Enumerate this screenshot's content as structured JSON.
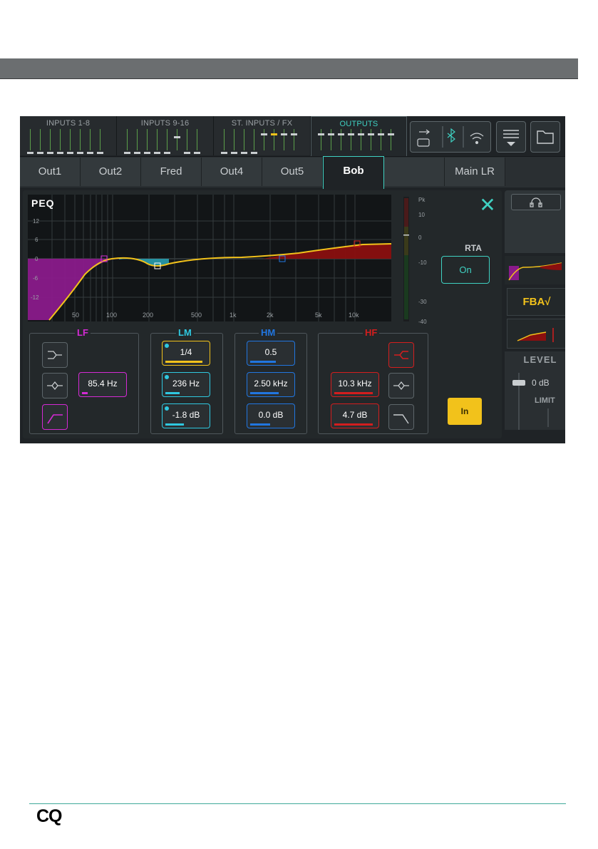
{
  "section_tabs": [
    "INPUTS 1-8",
    "INPUTS 9-16",
    "ST. INPUTS / FX",
    "OUTPUTS"
  ],
  "channel_tabs": [
    "Out1",
    "Out2",
    "Fred",
    "Out4",
    "Out5",
    "Bob",
    "",
    "Main LR"
  ],
  "active_channel": "Bob",
  "peq": {
    "title": "PEQ",
    "y_ticks": [
      "12",
      "6",
      "0",
      "-6",
      "-12"
    ],
    "x_ticks": [
      "50",
      "100",
      "200",
      "500",
      "1k",
      "2k",
      "5k",
      "10k"
    ],
    "meter_ticks": [
      "Pk",
      "10",
      "0",
      "-10",
      "-30",
      "-40"
    ]
  },
  "rta": {
    "label": "RTA",
    "state": "On"
  },
  "bands": {
    "lf": {
      "title": "LF",
      "freq": "85.4 Hz",
      "color": "#d42ad4"
    },
    "lm": {
      "title": "LM",
      "q": "1/4",
      "freq": "236 Hz",
      "gain": "-1.8 dB",
      "color": "#2fc8e0"
    },
    "hm": {
      "title": "HM",
      "q": "0.5",
      "freq": "2.50 kHz",
      "gain": "0.0 dB",
      "color": "#2176e0"
    },
    "hf": {
      "title": "HF",
      "freq": "10.3 kHz",
      "gain": "4.7 dB",
      "color": "#d41e1e"
    }
  },
  "in_button": "In",
  "side": {
    "fba": "FBA√",
    "level_label": "LEVEL",
    "level_value": "0 dB",
    "limit_label": "LIMIT"
  },
  "footer": {
    "logo": "CQ"
  },
  "colors": {
    "accent": "#3fd1c2",
    "in_yellow": "#f2c21b"
  }
}
